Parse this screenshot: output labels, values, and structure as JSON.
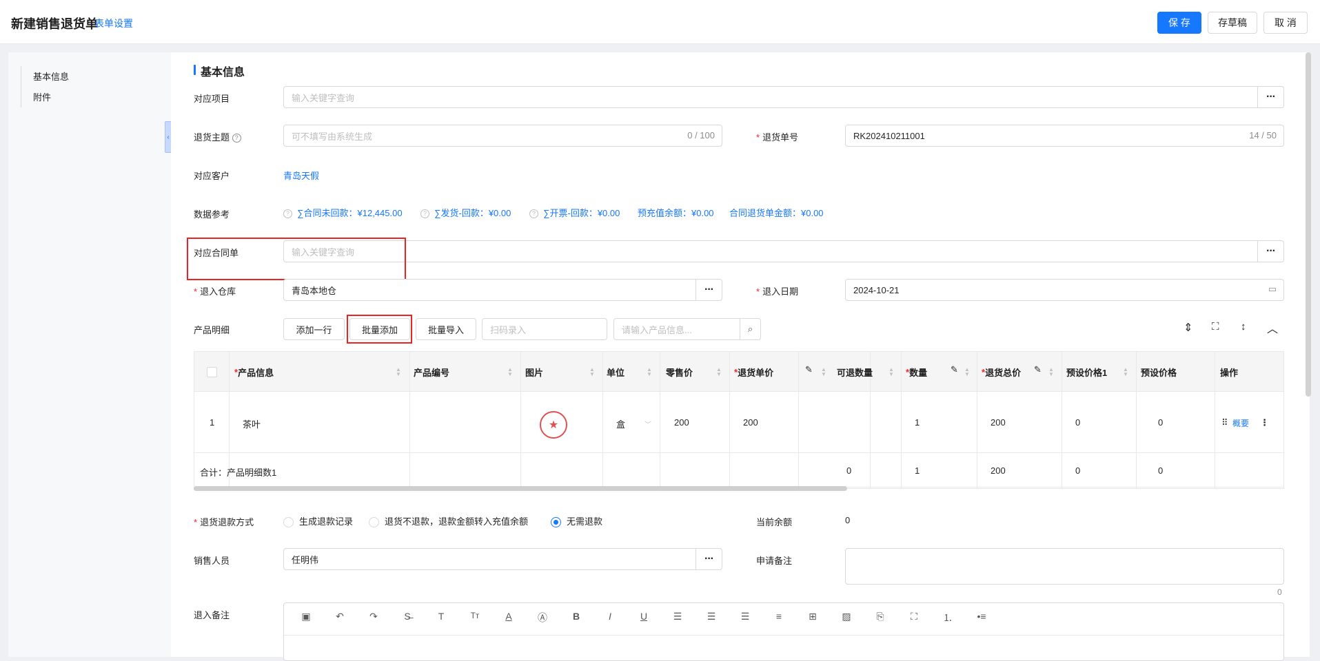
{
  "header": {
    "title": "新建销售退货单",
    "form_settings": "表单设置",
    "save": "保 存",
    "draft": "存草稿",
    "cancel": "取 消"
  },
  "sidebar": {
    "items": [
      {
        "label": "基本信息"
      },
      {
        "label": "附件"
      }
    ]
  },
  "section_title": "基本信息",
  "fields": {
    "project": {
      "label": "对应项目",
      "placeholder": "输入关键字查询"
    },
    "subject": {
      "label": "退货主题",
      "placeholder": "可不填写由系统生成",
      "counter": "0 / 100"
    },
    "return_no": {
      "label": "退货单号",
      "value": "RK202410211001",
      "counter": "14 / 50"
    },
    "customer": {
      "label": "对应客户",
      "value": "青岛天假"
    },
    "data_ref": {
      "label": "数据参考",
      "items": [
        "∑合同未回款：¥12,445.00",
        "∑发货-回款：¥0.00",
        "∑开票-回款：¥0.00",
        "预充值余额：¥0.00",
        "合同退货单金额：¥0.00"
      ]
    },
    "contract": {
      "label": "对应合同单",
      "placeholder": "输入关键字查询"
    },
    "warehouse": {
      "label": "退入仓库",
      "value": "青岛本地仓"
    },
    "return_date": {
      "label": "退入日期",
      "value": "2024-10-21"
    },
    "products": {
      "label": "产品明细",
      "add_row": "添加一行",
      "batch_add": "批量添加",
      "batch_import": "批量导入",
      "scan_placeholder": "扫码录入",
      "search_placeholder": "请输入产品信息..."
    },
    "refund_method": {
      "label": "退货退款方式",
      "options": [
        "生成退款记录",
        "退货不退款，退款金额转入充值余额",
        "无需退款"
      ],
      "selected": "无需退款"
    },
    "balance": {
      "label": "当前余额",
      "value": "0"
    },
    "sales_person": {
      "label": "销售人员",
      "value": "任明伟"
    },
    "remark": {
      "label": "申请备注",
      "counter": "0"
    },
    "return_remark": {
      "label": "退入备注"
    }
  },
  "table": {
    "headers": [
      "产品信息",
      "产品编号",
      "图片",
      "单位",
      "零售价",
      "退货单价",
      "可退数量",
      "数量",
      "退货总价",
      "预设价格1",
      "预设价格",
      "操作"
    ],
    "rows": [
      {
        "index": "1",
        "name": "茶叶",
        "code": "",
        "unit": "盒",
        "retail": "200",
        "price": "200",
        "returnable": "",
        "qty": "1",
        "total": "200",
        "preset1": "0",
        "preset2": "0",
        "action": "概要"
      }
    ],
    "summary": {
      "label": "合计：产品明细数1",
      "returnable": "0",
      "qty": "1",
      "total": "200",
      "preset1": "0",
      "preset2": "0"
    }
  }
}
